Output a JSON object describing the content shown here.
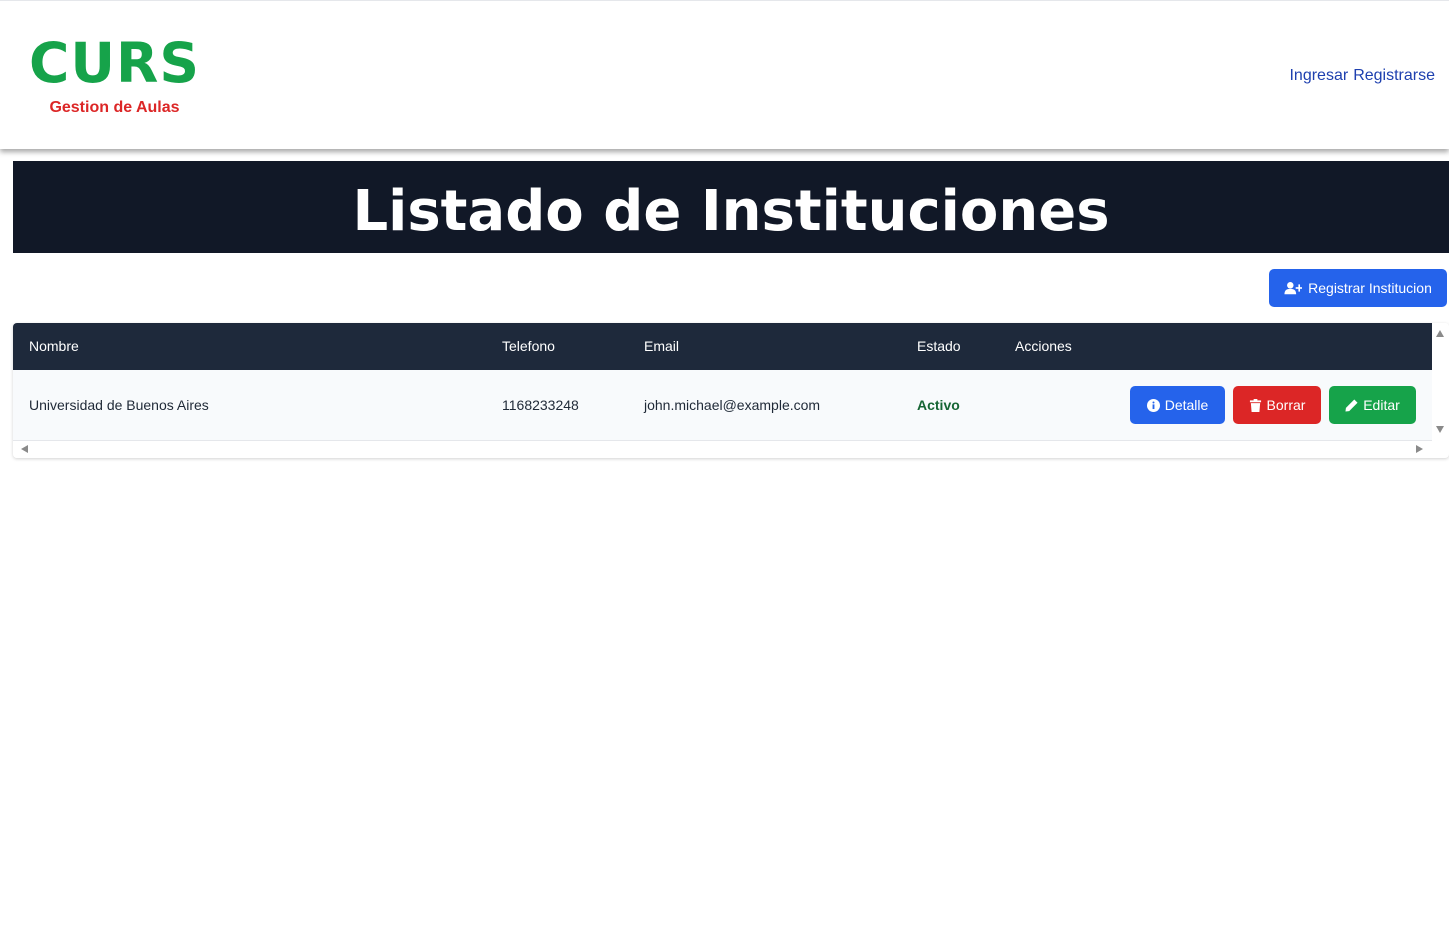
{
  "header": {
    "brand_title": "CURS",
    "brand_subtitle": "Gestion de Aulas",
    "login_label": "Ingresar",
    "register_label": "Registrarse"
  },
  "page": {
    "title": "Listado de Instituciones",
    "register_button_label": "Registrar Institucion",
    "register_button_icon": "user-plus-icon"
  },
  "table": {
    "columns": [
      "Nombre",
      "Telefono",
      "Email",
      "Estado",
      "Acciones"
    ],
    "rows": [
      {
        "nombre": "Universidad de Buenos Aires",
        "telefono": "1168233248",
        "email": "john.michael@example.com",
        "estado": "Activo",
        "actions": {
          "detail": "Detalle",
          "delete": "Borrar",
          "edit": "Editar"
        }
      }
    ]
  },
  "colors": {
    "brand": "#16a34a",
    "subtitle": "#dc2626",
    "banner_bg": "#111827",
    "table_header_bg": "#1e293b",
    "primary": "#2563eb",
    "danger": "#dc2626",
    "success": "#16a34a",
    "status_active": "#166534",
    "link": "#1e40af"
  }
}
